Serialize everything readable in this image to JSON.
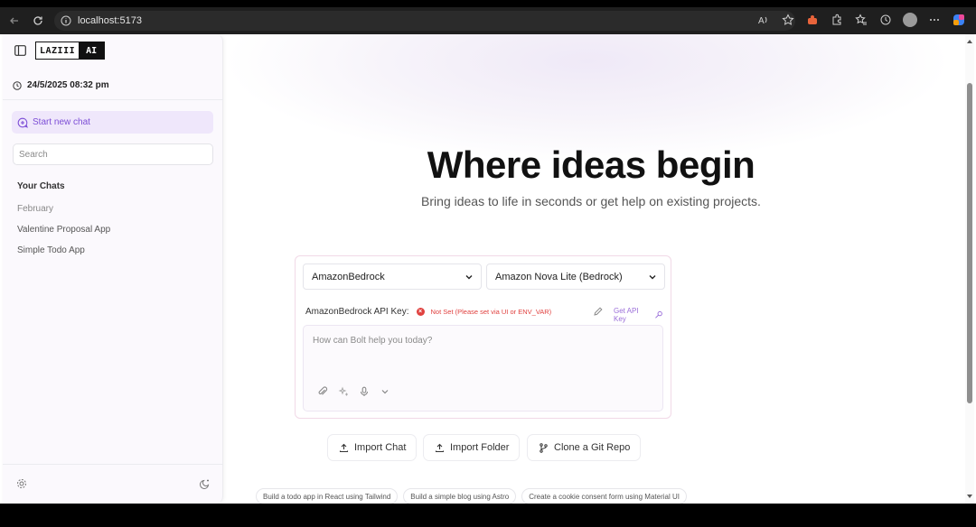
{
  "browser": {
    "url": "localhost:5173"
  },
  "sidebar": {
    "logo_left": "LAZIII",
    "logo_right": "AI",
    "datetime": "24/5/2025 08:32 pm",
    "new_chat_label": "Start new chat",
    "search_placeholder": "Search",
    "chats_title": "Your Chats",
    "group_label": "February",
    "chats": [
      {
        "label": "Valentine Proposal App"
      },
      {
        "label": "Simple Todo App"
      }
    ]
  },
  "main": {
    "headline": "Where ideas begin",
    "subline": "Bring ideas to life in seconds or get help on existing projects.",
    "provider_select": "AmazonBedrock",
    "model_select": "Amazon Nova Lite (Bedrock)",
    "api_label": "AmazonBedrock API Key:",
    "api_status": "Not Set (Please set via UI or ENV_VAR)",
    "get_api_key": "Get API Key",
    "prompt_placeholder": "How can Bolt help you today?",
    "actions": {
      "import_chat": "Import Chat",
      "import_folder": "Import Folder",
      "clone_repo": "Clone a Git Repo"
    },
    "examples": [
      "Build a todo app in React using Tailwind",
      "Build a simple blog using Astro",
      "Create a cookie consent form using Material UI"
    ]
  },
  "colors": {
    "accent": "#7c4dd6",
    "error": "#e0413f"
  }
}
